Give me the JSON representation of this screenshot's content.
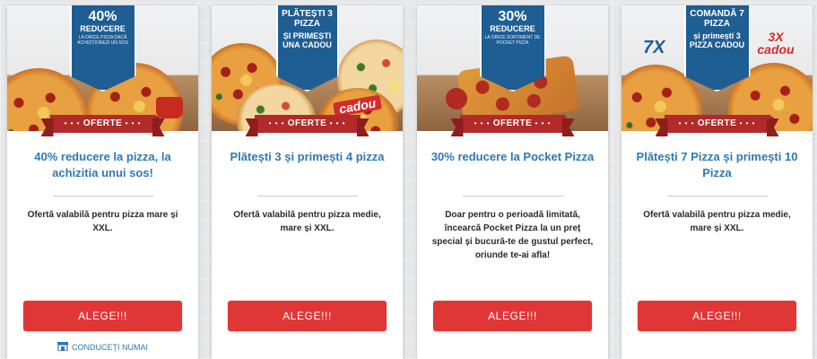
{
  "colors": {
    "brand_blue": "#2f78b8",
    "badge_blue": "#1f5e93",
    "button_red": "#e03636",
    "ribbon_red": "#b22a2a"
  },
  "offers": [
    {
      "badge_big": "40%",
      "badge_mid": "REDUCERE",
      "badge_small": "LA ORICE PIZZA DACĂ ACHIZIȚIONEZI UN SOS",
      "ribbon": "OFERTE",
      "title": "40% reducere la pizza, la achizitia unui sos!",
      "description": "Ofertă valabilă pentru pizza mare și XXL.",
      "button": "ALEGE!!!",
      "extra_link": "CONDUCEȚI NUMAI",
      "extra_icon": "store-icon"
    },
    {
      "badge_big": "PLĂTEȘTI 3 PIZZA",
      "badge_mid": "ȘI PRIMEȘTI UNA CADOU",
      "badge_small": "",
      "stamp": "cadou",
      "ribbon": "OFERTE",
      "title": "Plătești 3 și primești 4 pizza",
      "description": "Ofertă valabilă pentru pizza medie, mare și XXL.",
      "button": "ALEGE!!!"
    },
    {
      "badge_big": "30%",
      "badge_mid": "REDUCERE",
      "badge_small": "LA ORICE SORTIMENT DE POCKET PIZZA",
      "ribbon": "OFERTE",
      "title": "30% reducere la Pocket Pizza",
      "description": "Doar pentru o perioadă limitată, încearcă Pocket Pizza la un preț special și bucură-te de gustul perfect, oriunde te-ai afla!",
      "button": "ALEGE!!!"
    },
    {
      "badge_big": "COMANDĂ 7 PIZZA",
      "badge_mid": "și primești 3 PIZZA CADOU",
      "badge_small": "",
      "stamp_left": "7X",
      "stamp_right": "3X cadou",
      "ribbon": "OFERTE",
      "title": "Plătești 7 Pizza și primești 10 Pizza",
      "description": "Ofertă valabilă pentru pizza medie, mare și XXL.",
      "button": "ALEGE!!!"
    }
  ]
}
